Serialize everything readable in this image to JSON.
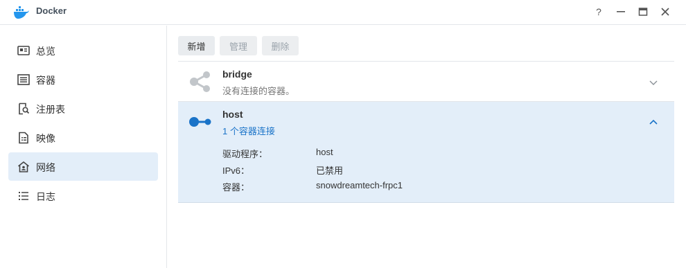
{
  "window": {
    "title": "Docker",
    "buttons": [
      "help-icon",
      "minimize-icon",
      "maximize-icon",
      "close-icon"
    ],
    "help_glyph": "?"
  },
  "sidebar": {
    "items": [
      {
        "label": "总览",
        "icon": "overview-card-icon",
        "active": false
      },
      {
        "label": "容器",
        "icon": "container-list-icon",
        "active": false
      },
      {
        "label": "注册表",
        "icon": "registry-search-icon",
        "active": false
      },
      {
        "label": "映像",
        "icon": "image-doc-icon",
        "active": false
      },
      {
        "label": "网络",
        "icon": "network-house-icon",
        "active": true
      },
      {
        "label": "日志",
        "icon": "log-list-icon",
        "active": false
      }
    ]
  },
  "toolbar": {
    "new_label": "新增",
    "manage_label": "管理",
    "delete_label": "删除"
  },
  "networks": [
    {
      "name": "bridge",
      "status": "没有连接的容器。",
      "expanded": false,
      "icon": "share-icon"
    },
    {
      "name": "host",
      "status": "1 个容器连接",
      "expanded": true,
      "icon": "host-connector-icon",
      "details": {
        "driver_label": "驱动程序：",
        "driver_value": "host",
        "ipv6_label": "IPv6：",
        "ipv6_value": "已禁用",
        "container_label": "容器：",
        "container_value": "snowdreamtech-frpc1"
      }
    }
  ],
  "colors": {
    "active_bg": "#e3eef9",
    "accent": "#1a73c8",
    "icon_gray": "#c2c6ca"
  }
}
